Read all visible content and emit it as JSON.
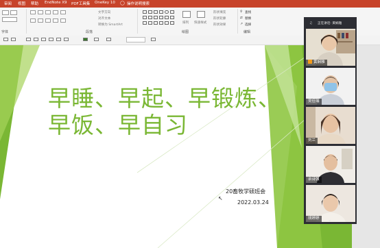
{
  "ribbon_tabs": [
    "审阅",
    "视图",
    "帮助",
    "EndNote X9",
    "PDF工具集",
    "OneKey 10",
    "操作说明搜索"
  ],
  "ribbon_groups": {
    "font_label": "字体",
    "paragraph_label": "段落",
    "drawing_label": "绘图",
    "editing_label": "编辑"
  },
  "ribbon_controls": {
    "text_direction": "文字方向",
    "align_text": "对齐文本",
    "smartart": "转换为 SmartArt",
    "arrange": "排列",
    "quick_styles": "快速样式",
    "shape_fill": "形状填充",
    "shape_outline": "形状轮廓",
    "shape_effects": "形状效果",
    "find": "查找",
    "replace": "替换",
    "select": "选择"
  },
  "slide": {
    "title_line1": "早睡、早起、早锻炼、",
    "title_line2": "早饭、早自习",
    "subtitle": "20畜牧学硕班会",
    "date": "2022.03.24"
  },
  "video_panel": {
    "header": "正在讲话: 黄娴雅",
    "participants": [
      {
        "name": "黄娴雅",
        "host": true
      },
      {
        "name": "吴佳瑞",
        "host": false
      },
      {
        "name": "刘兰",
        "host": false
      },
      {
        "name": "余诗强",
        "host": false
      },
      {
        "name": "胡婷婷",
        "host": false
      }
    ],
    "more": "⌄"
  },
  "colors": {
    "ribbon_red": "#c7432a",
    "title_green": "#7ab734",
    "panel_dark": "#2c2d33",
    "host_badge": "#f29b1d"
  }
}
